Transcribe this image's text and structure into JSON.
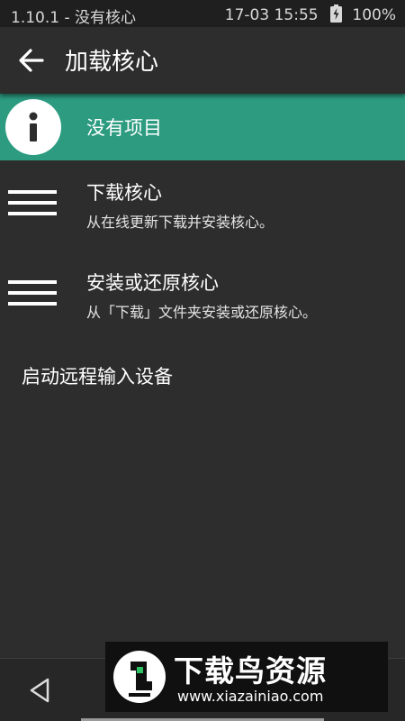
{
  "status_bar": {
    "app_status": "1.10.1 - 没有核心",
    "datetime": "17-03 15:55",
    "battery": "100%"
  },
  "app_bar": {
    "title": "加载核心"
  },
  "info_row": {
    "text": "没有项目",
    "icon": "info-icon"
  },
  "menu": {
    "items": [
      {
        "title": "下载核心",
        "subtitle": "从在线更新下载并安装核心。",
        "icon": "hamburger-icon"
      },
      {
        "title": "安装或还原核心",
        "subtitle": "从「下载」文件夹安装或还原核心。",
        "icon": "hamburger-icon"
      }
    ],
    "remote_input": "启动远程输入设备"
  },
  "nav_bar": {
    "back_icon": "triangle-back-icon"
  },
  "watermark": {
    "title": "下载鸟资源",
    "url": "www.xiazainiao.com"
  },
  "colors": {
    "background": "#2d2d2d",
    "status_bar": "#1f1f1f",
    "accent": "#2c9b80",
    "text": "#ffffff"
  }
}
